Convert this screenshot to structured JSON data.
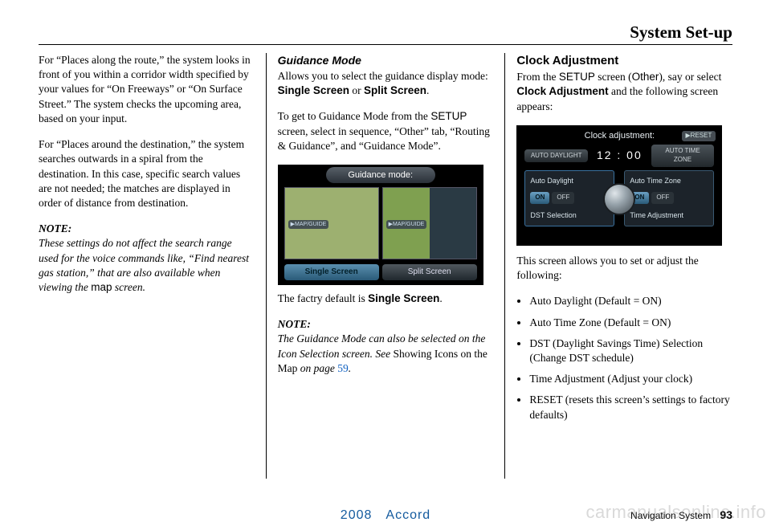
{
  "header": {
    "title": "System Set-up"
  },
  "col1": {
    "p1": "For “Places along the route,” the system looks in front of you within a corridor width specified by your values for “On Freeways” or “On Surface Street.” The system checks the upcoming area, based on your input.",
    "p2": "For “Places around the destination,” the system searches outwards in a spiral from the destination. In this case, specific search values are not needed; the matches are displayed in order of distance from destination.",
    "note_hd": "NOTE:",
    "note_body_a": "These settings do not affect the search range used for the voice commands like, “Find nearest gas station,” that are also available when viewing the ",
    "note_body_map": "map",
    "note_body_b": " screen."
  },
  "col2": {
    "heading": "Guidance Mode",
    "p1a": "Allows you to select the guidance display mode: ",
    "p1_single": "Single Screen",
    "p1_or": " or ",
    "p1_split": "Split Screen",
    "p1_end": ".",
    "p2a": "To get to Guidance Mode from the ",
    "p2_setup": "SETUP",
    "p2b": " screen, select in sequence, “Other” tab, “Routing & Guidance”, and “Guidance Mode”.",
    "shot": {
      "title": "Guidance mode:",
      "btn_single": "Single Screen",
      "btn_split": "Split Screen"
    },
    "default_a": "The factry default is ",
    "default_b": "Single Screen",
    "default_c": ".",
    "note_hd": "NOTE:",
    "note_a": "The Guidance Mode can also be selected on the Icon Selection screen. See ",
    "note_ref": "Showing Icons on the Map",
    "note_b": " on page ",
    "note_pg": "59",
    "note_c": "."
  },
  "col3": {
    "heading": "Clock Adjustment",
    "p1a": "From the ",
    "p1_setup": "SETUP",
    "p1b": " screen (",
    "p1_other": "Other",
    "p1c": "), say or select ",
    "p1_clock": "Clock Adjustment",
    "p1d": " and the following screen appears:",
    "shot": {
      "title": "Clock adjustment:",
      "reset": "▶RESET",
      "auto_daylight_pill": "AUTO DAYLIGHT",
      "time": "12 : 00",
      "auto_timezone_pill": "AUTO TIME ZONE",
      "left_label": "Auto Daylight",
      "on": "ON",
      "off": "OFF",
      "dst": "DST Selection",
      "right_label": "Auto Time Zone",
      "time_adj": "Time Adjustment"
    },
    "p2": "This screen allows you to set or adjust the following:",
    "bullets": [
      "Auto Daylight (Default = ON)",
      "Auto Time Zone (Default = ON)",
      "DST (Daylight Savings Time) Selection (Change DST schedule)",
      "Time Adjustment (Adjust your clock)",
      "RESET (resets this screen’s settings to factory defaults)"
    ]
  },
  "footer": {
    "year_model": "2008 Accord",
    "label": "Navigation System",
    "page": "93"
  },
  "watermark": "carmanualsonline.info"
}
